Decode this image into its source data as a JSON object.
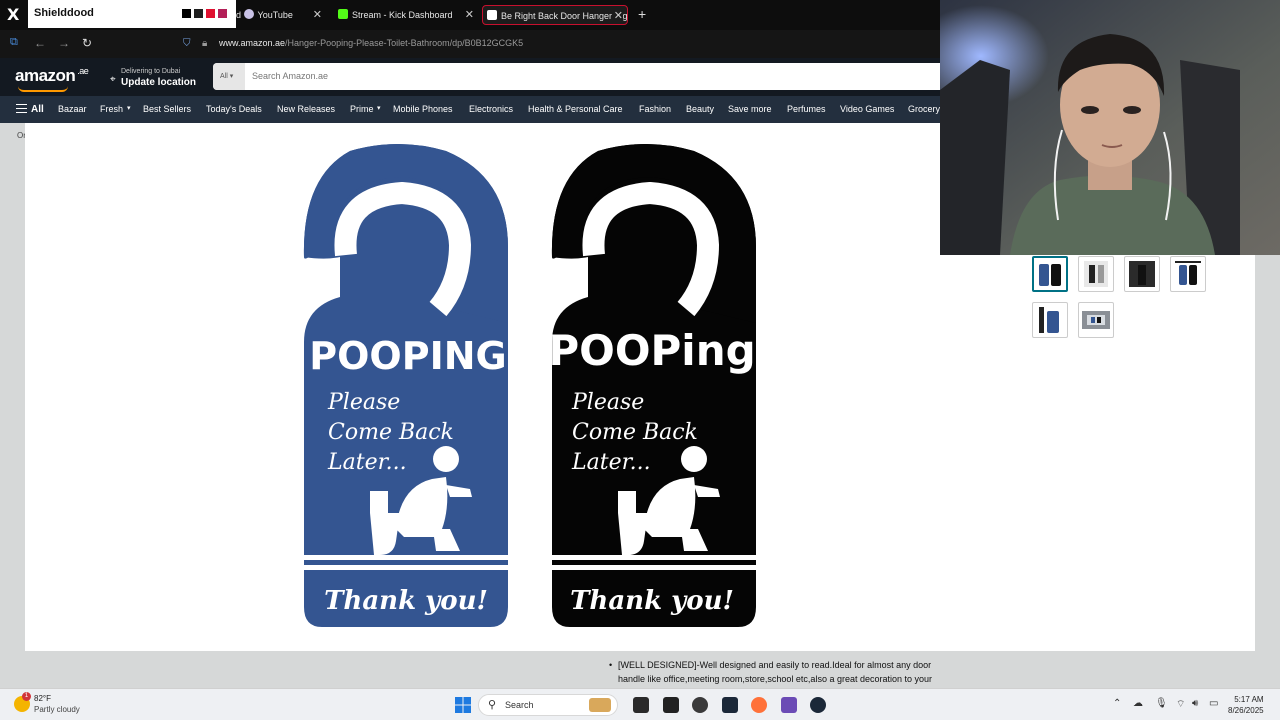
{
  "overlay": {
    "name": "Shielddood",
    "swatches": [
      "#000000",
      "#1f1f1f",
      "#e0102f",
      "#b31f58",
      "#7b3fc4"
    ]
  },
  "browser": {
    "tabs": [
      {
        "label": "YouTube",
        "prefix": "d",
        "icon_color": "#c9c2e6"
      },
      {
        "label": "Stream - Kick Dashboard",
        "icon_color": "#53fc18"
      },
      {
        "label": "Be Right Back Door Hanger Sig",
        "icon_color": "#ffffff",
        "active": true
      }
    ],
    "url_host": "www.amazon.ae",
    "url_path": "/Hanger-Pooping-Please-Toilet-Bathroom/dp/B0B12GCGK5"
  },
  "amazon": {
    "logo": "amazon",
    "logo_suffix": ".ae",
    "deliver_line1": "Delivering to Dubai",
    "deliver_line2": "Update location",
    "search_category": "All",
    "search_placeholder": "Search Amazon.ae",
    "nav_all": "All",
    "nav_items": [
      "Bazaar",
      "Fresh",
      "Best Sellers",
      "Today's Deals",
      "New Releases",
      "Prime",
      "Mobile Phones",
      "Electronics",
      "Health & Personal Care",
      "Fashion",
      "Beauty",
      "Save more",
      "Perfumes",
      "Video Games",
      "Grocery"
    ],
    "crumb_fragment": "Or"
  },
  "product_image": {
    "left_hanger": {
      "color": "#345591",
      "headline": "POOPING",
      "message_lines": [
        "Please",
        "Come Back",
        "Later..."
      ],
      "footer": "Thank you!"
    },
    "right_hanger": {
      "color": "#050505",
      "headline": "POOPing",
      "message_lines": [
        "Please",
        "Come Back",
        "Later..."
      ],
      "footer": "Thank you!"
    }
  },
  "bullet_text": "[WELL DESIGNED]-Well designed and easily to read.Ideal for almost any door handle like office,meeting room,store,school etc,also a great decoration to your",
  "taskbar": {
    "weather_temp": "82°F",
    "weather_condition": "Partly cloudy",
    "weather_badge": "1",
    "search_label": "Search",
    "time": "5:17 AM",
    "date": "8/26/2025"
  }
}
